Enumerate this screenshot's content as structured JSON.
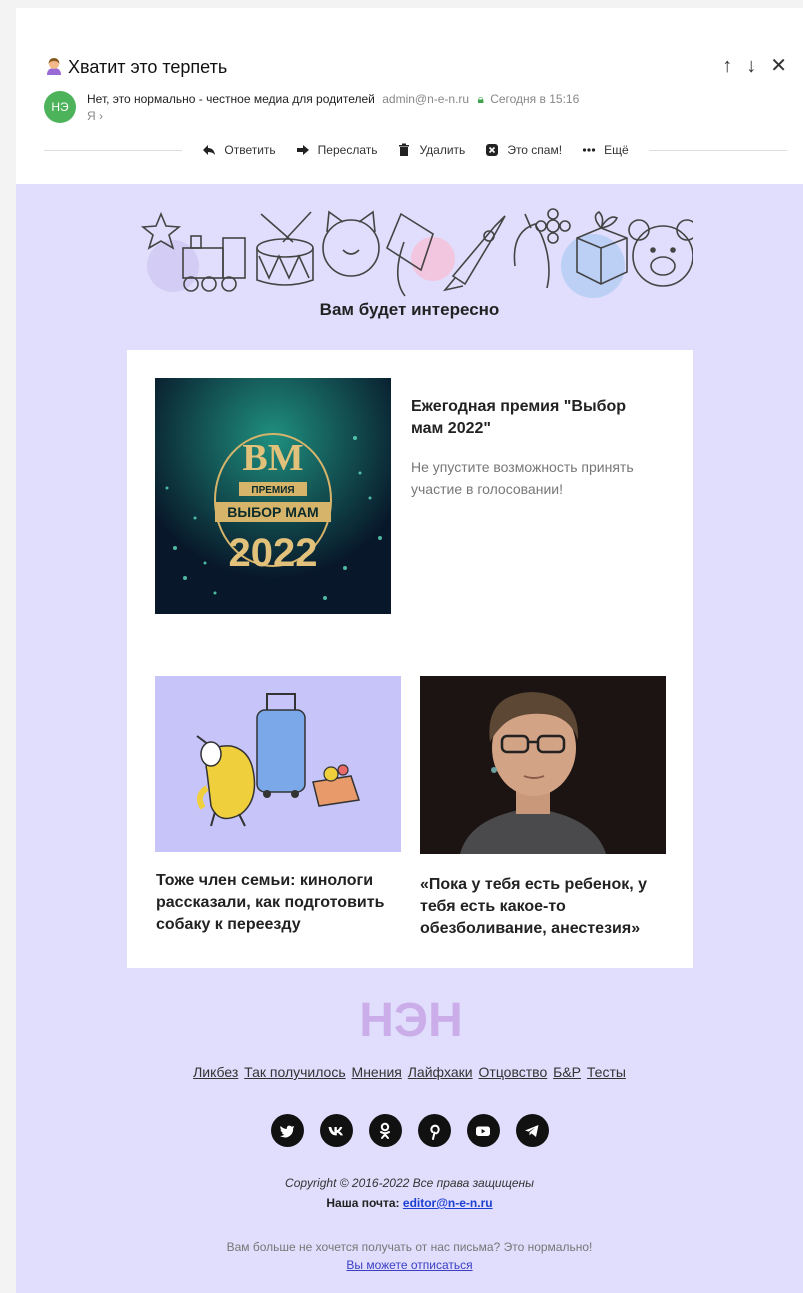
{
  "mail": {
    "subject": "Хватит это терпеть",
    "sender_initials": "НЭ",
    "sender_name": "Нет, это нормально - честное медиа для родителей",
    "sender_email": "admin@n-e-n.ru",
    "date": "Сегодня в 15:16",
    "recipient": "Я",
    "actions": {
      "reply": "Ответить",
      "forward": "Переслать",
      "delete": "Удалить",
      "spam": "Это спам!",
      "more": "Ещё"
    }
  },
  "newsletter": {
    "section_title": "Вам будет интересно",
    "feature": {
      "title": "Ежегодная премия \"Выбор мам 2022\"",
      "text": "Не упустите возможность принять участие в голосовании!",
      "badge_line1": "ПРЕМИЯ",
      "badge_line2": "ВЫБОР МАМ",
      "badge_year": "2022",
      "badge_mark": "ВМ"
    },
    "articles": [
      {
        "title": "Тоже член семьи: кинологи рассказали, как подготовить собаку к переезду"
      },
      {
        "title": "«Пока у тебя есть ребенок, у тебя есть какое-то обезболивание, анестезия»"
      }
    ],
    "logo_text": "НЭН",
    "footer_links": [
      "Ликбез",
      "Так получилось",
      "Мнения",
      "Лайфхаки",
      "Отцовство",
      "Б&Р",
      "Тесты"
    ],
    "copyright": "Copyright © 2016-2022 Все права защищены",
    "mail_label": "Наша почта:",
    "mail_address": "editor@n-e-n.ru",
    "unsubscribe_text": "Вам больше не хочется получать от нас письма? Это нормально!",
    "unsubscribe_link": "Вы можете отписаться"
  },
  "colors": {
    "body_bg": "#e0defc",
    "avatar_green": "#4db35b",
    "link_blue": "#1c3fd1"
  }
}
